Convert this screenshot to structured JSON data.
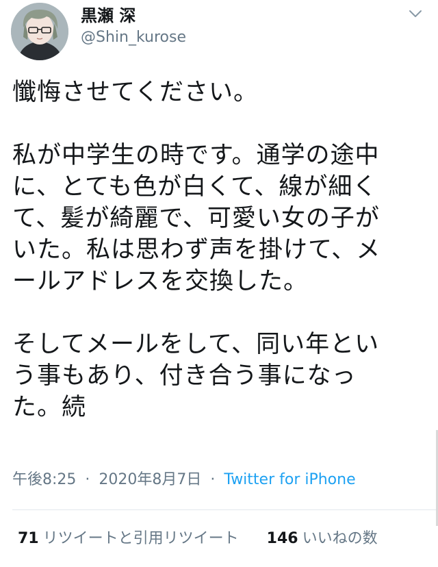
{
  "user": {
    "display_name": "黒瀬 深",
    "handle": "@Shin_kurose",
    "avatar_icon": "avatar-glasses-icon"
  },
  "menu": {
    "icon": "chevron-down-icon"
  },
  "tweet": {
    "paragraphs": [
      [
        "懺悔させてください。"
      ],
      [
        "私が中学生の時です。通学の途中",
        "に、とても色が白くて、線が細く",
        "て、髪が綺麗で、可愛い女の子が",
        "いた。私は思わず声を掛けて、メ",
        "ールアドレスを交換した。"
      ],
      [
        "そしてメールをして、同い年とい",
        "う事もあり、付き合う事になっ",
        "た。続"
      ]
    ]
  },
  "meta": {
    "time": "午後8:25",
    "date": "2020年8月7日",
    "separator": "·",
    "source": "Twitter for iPhone"
  },
  "stats": {
    "retweets_count": "71",
    "retweets_label": "リツイートと引用リツイート",
    "likes_count": "146",
    "likes_label": "いいねの数"
  },
  "colors": {
    "text_primary": "#14171a",
    "text_secondary": "#657786",
    "link": "#1da1f2",
    "divider": "#e1e8ed"
  }
}
